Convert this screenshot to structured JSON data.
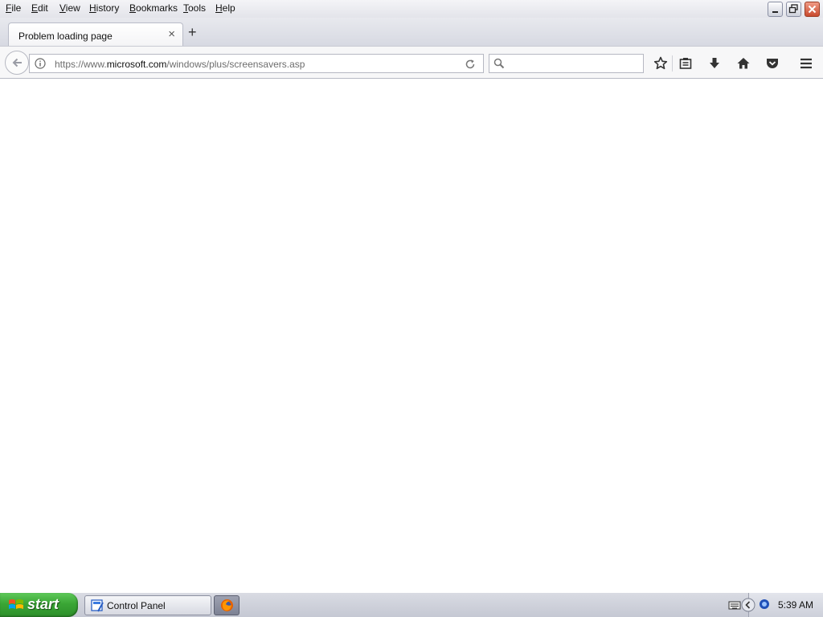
{
  "menubar": {
    "items": [
      {
        "label": "File"
      },
      {
        "label": "Edit"
      },
      {
        "label": "View"
      },
      {
        "label": "History"
      },
      {
        "label": "Bookmarks"
      },
      {
        "label": "Tools"
      },
      {
        "label": "Help"
      }
    ]
  },
  "tabs": [
    {
      "title": "Problem loading page",
      "close": "×"
    }
  ],
  "newtab_label": "+",
  "navbar": {
    "url_prefix": "https://www.",
    "url_host": "microsoft.com",
    "url_path": "/windows/plus/screensavers.asp",
    "search_placeholder": ""
  },
  "taskbar": {
    "start_label": "start",
    "tasks": [
      {
        "label": "Control Panel",
        "icon": "control-panel-icon"
      },
      {
        "label": "",
        "icon": "firefox-icon"
      }
    ],
    "clock": "5:39 AM"
  },
  "colors": {
    "taskbar_blue": "#245edb",
    "start_green": "#3aa635",
    "close_red": "#c94a2e"
  }
}
